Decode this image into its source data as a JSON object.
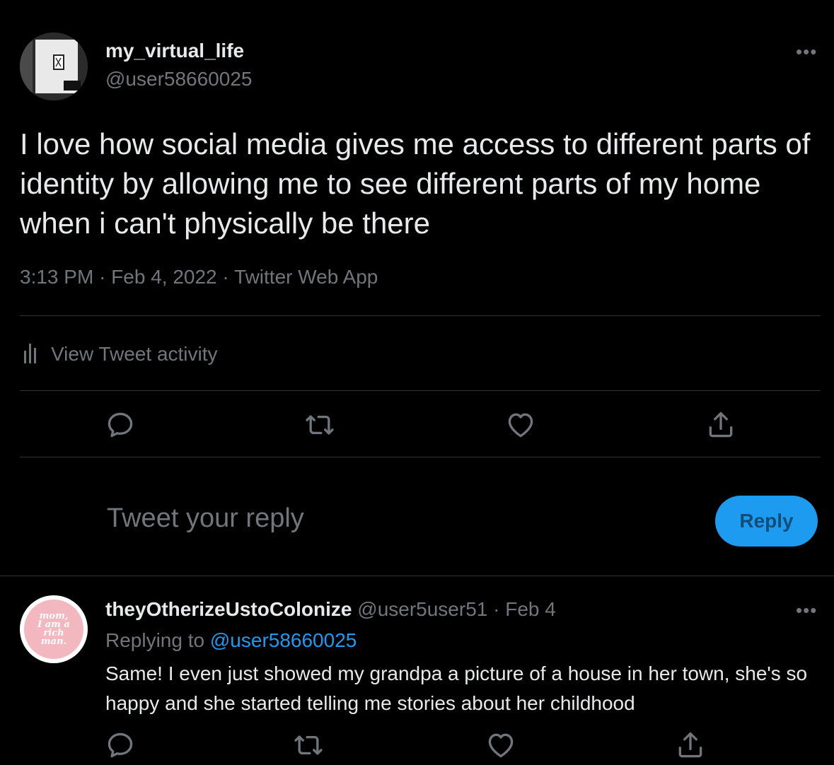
{
  "tweet": {
    "display_name": "my_virtual_life",
    "handle": "@user58660025",
    "more_icon": "•••",
    "text": "I love how social media gives me access to different parts of identity by allowing me to see different parts of my home when i can't physically be there",
    "time": "3:13 PM",
    "date": "Feb 4, 2022",
    "source": "Twitter Web App",
    "separator": "·",
    "activity_label": "View Tweet activity"
  },
  "composer": {
    "placeholder": "Tweet your reply",
    "reply_button": "Reply"
  },
  "reply": {
    "display_name": "theyOtherizeUstoColonize",
    "handle": "@user5user51",
    "separator": "·",
    "date": "Feb 4",
    "replying_prefix": "Replying to",
    "replying_to": "@user58660025",
    "text": "Same! I even just showed my grandpa a picture of a house in her town, she's so happy and she started telling me stories about her childhood",
    "avatar_text": [
      "mom,",
      "I am a",
      "rich",
      "man."
    ]
  },
  "colors": {
    "background": "#000000",
    "text": "#e7e9ea",
    "muted": "#71767b",
    "accent": "#1d9bf0",
    "divider": "#2f3336"
  },
  "icons": {
    "reply": "reply-icon",
    "retweet": "retweet-icon",
    "like": "like-icon",
    "share": "share-icon",
    "activity": "bar-chart-icon"
  }
}
